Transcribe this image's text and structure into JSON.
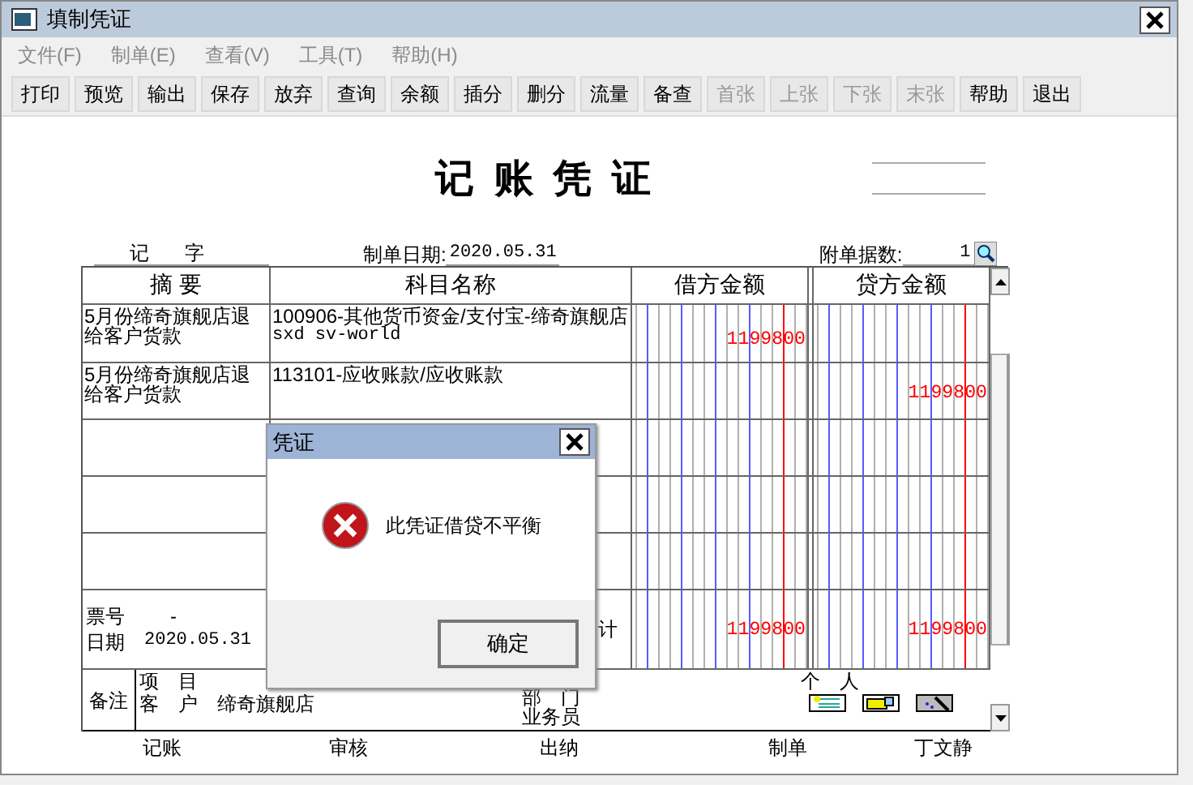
{
  "window": {
    "title": "填制凭证"
  },
  "menu": [
    {
      "label": "文件(F)",
      "disabled": true
    },
    {
      "label": "制单(E)",
      "disabled": true
    },
    {
      "label": "查看(V)",
      "disabled": true
    },
    {
      "label": "工具(T)",
      "disabled": true
    },
    {
      "label": "帮助(H)",
      "disabled": true
    }
  ],
  "toolbar": [
    {
      "label": "打印",
      "disabled": false
    },
    {
      "label": "预览",
      "disabled": false
    },
    {
      "label": "输出",
      "disabled": false
    },
    {
      "label": "保存",
      "disabled": false
    },
    {
      "label": "放弃",
      "disabled": false
    },
    {
      "label": "查询",
      "disabled": false
    },
    {
      "label": "余额",
      "disabled": false
    },
    {
      "label": "插分",
      "disabled": false
    },
    {
      "label": "删分",
      "disabled": false
    },
    {
      "label": "流量",
      "disabled": false
    },
    {
      "label": "备查",
      "disabled": false
    },
    {
      "label": "首张",
      "disabled": true
    },
    {
      "label": "上张",
      "disabled": true
    },
    {
      "label": "下张",
      "disabled": true
    },
    {
      "label": "末张",
      "disabled": true
    },
    {
      "label": "帮助",
      "disabled": false
    },
    {
      "label": "退出",
      "disabled": false
    }
  ],
  "voucher": {
    "title": "记 账 凭 证",
    "word": "记",
    "word_suffix": "字",
    "date_label": "制单日期:",
    "date": "2020.05.31",
    "attachments_label": "附单据数:",
    "attachments": "1",
    "columns": [
      "摘 要",
      "科目名称",
      "借方金额",
      "贷方金额"
    ],
    "entries": [
      {
        "summary": "5月份缔奇旗舰店退给客户货款",
        "account": "100906-其他货币资金/支付宝-缔奇旗舰店",
        "account_detail": "sxd sv-world",
        "debit": "1199800"
      },
      {
        "summary": "5月份缔奇旗舰店退给客户货款",
        "account": "113101-应收账款/应收账款",
        "credit": "1199800"
      }
    ],
    "totals": {
      "ticket_label": "票号",
      "ticket": "-",
      "date_label": "日期",
      "date": "2020.05.31",
      "total_label": "计",
      "debit": "1199800",
      "credit": "1199800"
    },
    "notes": {
      "label": "备注",
      "project_label": "项　目",
      "customer_label": "客　户",
      "customer": "缔奇旗舰店",
      "department_label": "部　门",
      "salesperson_label": "业务员",
      "person_label": "个　人"
    },
    "footer": [
      "记账",
      "审核",
      "出纳",
      "制单"
    ],
    "maker": "丁文静"
  },
  "dialog": {
    "title": "凭证",
    "message": "此凭证借贷不平衡",
    "button": "确定"
  }
}
